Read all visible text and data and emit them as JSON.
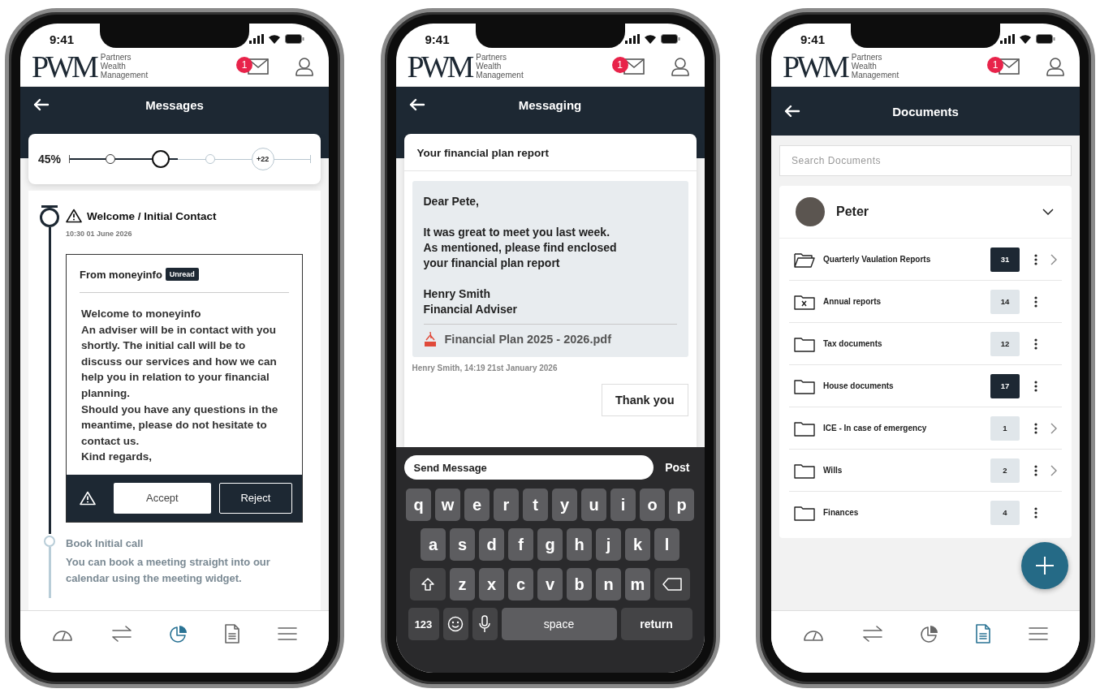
{
  "phones": [
    {
      "kind": "messages",
      "time": "9:41",
      "logo": "PWM",
      "logo_lines": [
        "Partners",
        "Wealth",
        "Management"
      ],
      "mail_badge": "1",
      "title": "Messages",
      "progress": {
        "percent": "45%",
        "level": 0.45,
        "nodes": [
          {
            "kind": "step",
            "done": true
          },
          {
            "kind": "current",
            "done": true
          },
          {
            "kind": "step",
            "done": false
          },
          {
            "kind": "more",
            "label": "+22",
            "done": false
          }
        ]
      },
      "steps": [
        {
          "active": true,
          "warning": true,
          "title": "Welcome / Initial Contact",
          "time": "10:30 01 June 2026",
          "message": {
            "from": "From moneyinfo",
            "tag": "Unread",
            "paragraphs": [
              "Welcome to moneyinfo",
              "An adviser will be in contact with you shortly. The initial call will be to discuss our services and how we can help you in relation to your financial planning.",
              "Should you have any questions in the meantime, please do not hesitate to contact us.",
              "Kind regards,"
            ],
            "actions": [
              {
                "kind": "primary",
                "label": "Accept"
              },
              {
                "kind": "outline",
                "label": "Reject"
              }
            ]
          }
        },
        {
          "active": false,
          "warning": false,
          "title": "Book Initial call",
          "text": "You can book a meeting straight into our calendar using the meeting widget."
        }
      ],
      "nav": [
        {
          "kind": "gauge",
          "selected": false
        },
        {
          "kind": "swap",
          "selected": false
        },
        {
          "kind": "pie",
          "selected": true
        },
        {
          "kind": "doc",
          "selected": false
        },
        {
          "kind": "menu",
          "selected": false
        }
      ]
    },
    {
      "kind": "messaging",
      "time": "9:41",
      "logo": "PWM",
      "logo_lines": [
        "Partners",
        "Wealth",
        "Management"
      ],
      "mail_badge": "1",
      "title": "Messaging",
      "thread": {
        "subject": "Your financial plan report",
        "greeting": "Dear Pete,",
        "body_lines": [
          "It was great to meet you last week.",
          "As mentioned, please find enclosed",
          "your financial plan report"
        ],
        "signature": [
          "Henry Smith",
          "Financial Adviser"
        ],
        "attachment": "Financial Plan 2025 - 2026.pdf",
        "meta": "Henry Smith, 14:19 21st January 2026",
        "reply": "Thank you"
      },
      "composer": {
        "placeholder": "Send Message",
        "button": "Post"
      },
      "keyboard": {
        "rows": [
          {
            "keys": [
              {
                "kind": "letter",
                "label": "q"
              },
              {
                "kind": "letter",
                "label": "w"
              },
              {
                "kind": "letter",
                "label": "e"
              },
              {
                "kind": "letter",
                "label": "r"
              },
              {
                "kind": "letter",
                "label": "t"
              },
              {
                "kind": "letter",
                "label": "y"
              },
              {
                "kind": "letter",
                "label": "u"
              },
              {
                "kind": "letter",
                "label": "i"
              },
              {
                "kind": "letter",
                "label": "o"
              },
              {
                "kind": "letter",
                "label": "p"
              }
            ]
          },
          {
            "keys": [
              {
                "kind": "letter",
                "label": "a"
              },
              {
                "kind": "letter",
                "label": "s"
              },
              {
                "kind": "letter",
                "label": "d"
              },
              {
                "kind": "letter",
                "label": "f"
              },
              {
                "kind": "letter",
                "label": "g"
              },
              {
                "kind": "letter",
                "label": "h"
              },
              {
                "kind": "letter",
                "label": "j"
              },
              {
                "kind": "letter",
                "label": "k"
              },
              {
                "kind": "letter",
                "label": "l"
              }
            ]
          },
          {
            "keys": [
              {
                "kind": "shift"
              },
              {
                "kind": "letter",
                "label": "z"
              },
              {
                "kind": "letter",
                "label": "x"
              },
              {
                "kind": "letter",
                "label": "c"
              },
              {
                "kind": "letter",
                "label": "v"
              },
              {
                "kind": "letter",
                "label": "b"
              },
              {
                "kind": "letter",
                "label": "n"
              },
              {
                "kind": "letter",
                "label": "m"
              },
              {
                "kind": "delete"
              }
            ]
          },
          {
            "keys": [
              {
                "kind": "mode",
                "label": "123"
              },
              {
                "kind": "emoji"
              },
              {
                "kind": "mic"
              },
              {
                "kind": "space",
                "label": "space"
              },
              {
                "kind": "return",
                "label": "return"
              }
            ]
          }
        ]
      }
    },
    {
      "kind": "documents",
      "time": "9:41",
      "logo": "PWM",
      "logo_lines": [
        "Partners",
        "Wealth",
        "Management"
      ],
      "mail_badge": "1",
      "title": "Documents",
      "search": {
        "placeholder": "Search Documents"
      },
      "person": {
        "name": "Peter"
      },
      "folders": [
        {
          "name": "Quarterly Vaulation Reports",
          "kind": "open",
          "count": "31",
          "highlighted": true,
          "chevron": true
        },
        {
          "name": "Annual reports",
          "kind": "x",
          "count": "14",
          "highlighted": false,
          "chevron": false
        },
        {
          "name": "Tax documents",
          "kind": "plain",
          "count": "12",
          "highlighted": false,
          "chevron": false
        },
        {
          "name": "House documents",
          "kind": "plain",
          "count": "17",
          "highlighted": true,
          "chevron": false
        },
        {
          "name": "ICE - In case of emergency",
          "kind": "plain",
          "count": "1",
          "highlighted": false,
          "chevron": true
        },
        {
          "name": "Wills",
          "kind": "plain",
          "count": "2",
          "highlighted": false,
          "chevron": true
        },
        {
          "name": "Finances",
          "kind": "plain",
          "count": "4",
          "highlighted": false,
          "chevron": false
        }
      ],
      "nav": [
        {
          "kind": "gauge",
          "selected": false
        },
        {
          "kind": "swap",
          "selected": false
        },
        {
          "kind": "pie",
          "selected": false
        },
        {
          "kind": "doc",
          "selected": true
        },
        {
          "kind": "menu",
          "selected": false
        }
      ]
    }
  ]
}
